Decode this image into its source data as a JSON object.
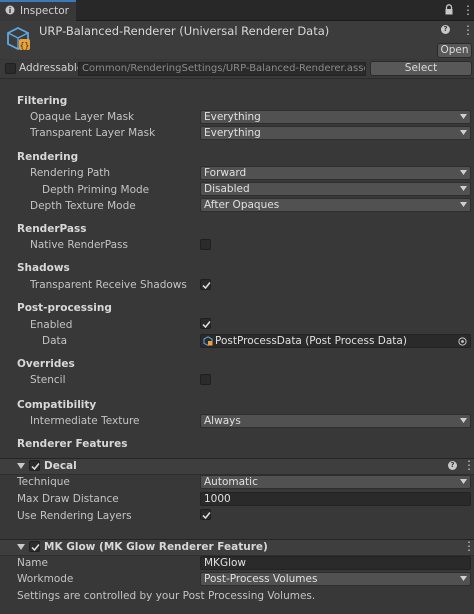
{
  "window": {
    "tab_title": "Inspector"
  },
  "header": {
    "title": "URP-Balanced-Renderer (Universal Renderer Data)",
    "open_label": "Open"
  },
  "addressable": {
    "label": "Addressable",
    "checked": false,
    "path": "Common/RenderingSettings/URP-Balanced-Renderer.asset",
    "select_label": "Select"
  },
  "filtering": {
    "title": "Filtering",
    "opaque_label": "Opaque Layer Mask",
    "opaque_value": "Everything",
    "transparent_label": "Transparent Layer Mask",
    "transparent_value": "Everything"
  },
  "rendering": {
    "title": "Rendering",
    "path_label": "Rendering Path",
    "path_value": "Forward",
    "priming_label": "Depth Priming Mode",
    "priming_value": "Disabled",
    "depth_label": "Depth Texture Mode",
    "depth_value": "After Opaques"
  },
  "renderpass": {
    "title": "RenderPass",
    "native_label": "Native RenderPass",
    "native_checked": false
  },
  "shadows": {
    "title": "Shadows",
    "receive_label": "Transparent Receive Shadows",
    "receive_checked": true
  },
  "postprocessing": {
    "title": "Post-processing",
    "enabled_label": "Enabled",
    "enabled_checked": true,
    "data_label": "Data",
    "data_value": "PostProcessData (Post Process Data)"
  },
  "overrides": {
    "title": "Overrides",
    "stencil_label": "Stencil",
    "stencil_checked": false
  },
  "compatibility": {
    "title": "Compatibility",
    "intermediate_label": "Intermediate Texture",
    "intermediate_value": "Always"
  },
  "features": {
    "title": "Renderer Features",
    "decal": {
      "name": "Decal",
      "enabled": true,
      "technique_label": "Technique",
      "technique_value": "Automatic",
      "distance_label": "Max Draw Distance",
      "distance_value": "1000",
      "layers_label": "Use Rendering Layers",
      "layers_checked": true
    },
    "mkglow": {
      "name": "MK Glow (MK Glow Renderer Feature)",
      "enabled": true,
      "name_label": "Name",
      "name_value": "MKGlow",
      "workmode_label": "Workmode",
      "workmode_value": "Post-Process Volumes",
      "note": "Settings are controlled by your Post Processing Volumes."
    }
  },
  "colors": {
    "background": "#383838",
    "accent": "#3a79bb",
    "field": "#515151"
  }
}
